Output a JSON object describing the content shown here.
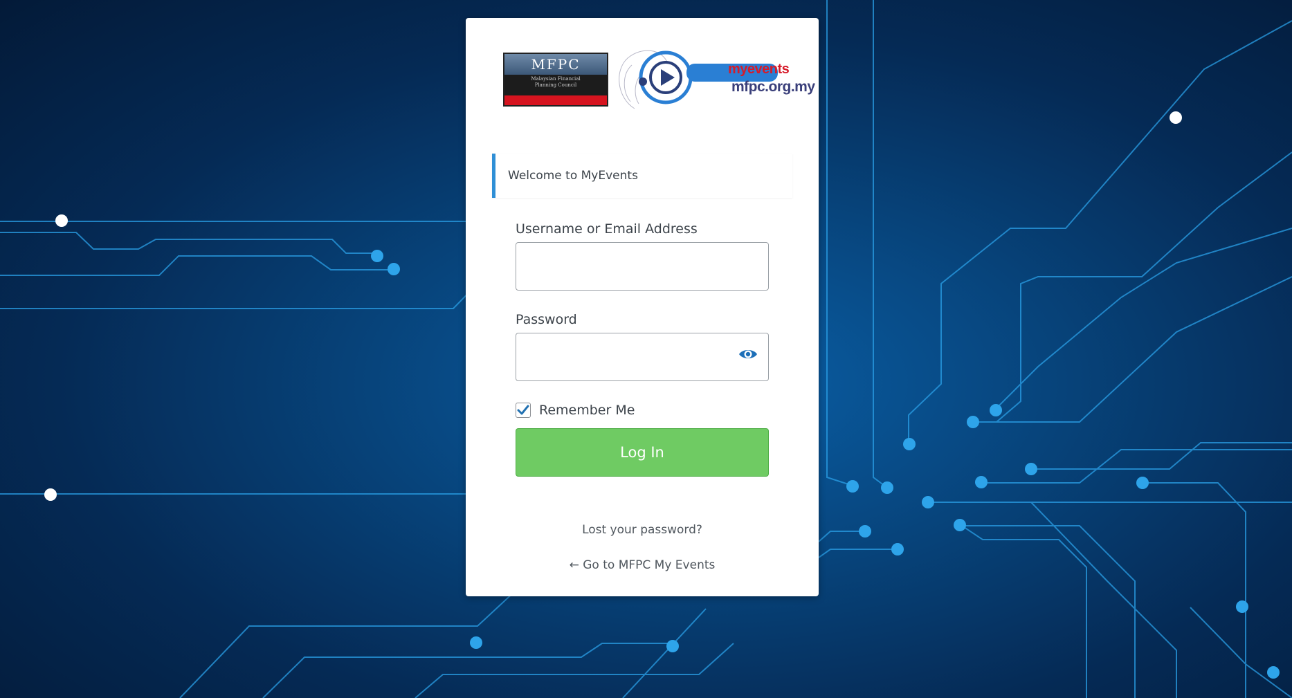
{
  "brand": {
    "org_short": "MFPC",
    "org_full_line1": "Malaysian Financial",
    "org_full_line2": "Planning Council",
    "product": "myevents",
    "site": "mfpc.org.my"
  },
  "welcome": {
    "message": "Welcome to MyEvents"
  },
  "form": {
    "username_label": "Username or Email Address",
    "username_value": "",
    "password_label": "Password",
    "password_value": "",
    "show_password_icon": "eye-icon",
    "remember_label": "Remember Me",
    "remember_checked": true,
    "submit_label": "Log In"
  },
  "links": {
    "lost_password": "Lost your password?",
    "back_to_site": "← Go to MFPC My Events"
  },
  "colors": {
    "accent_blue": "#2f8fd6",
    "login_green": "#6fcb63",
    "background_navy": "#052a55"
  }
}
